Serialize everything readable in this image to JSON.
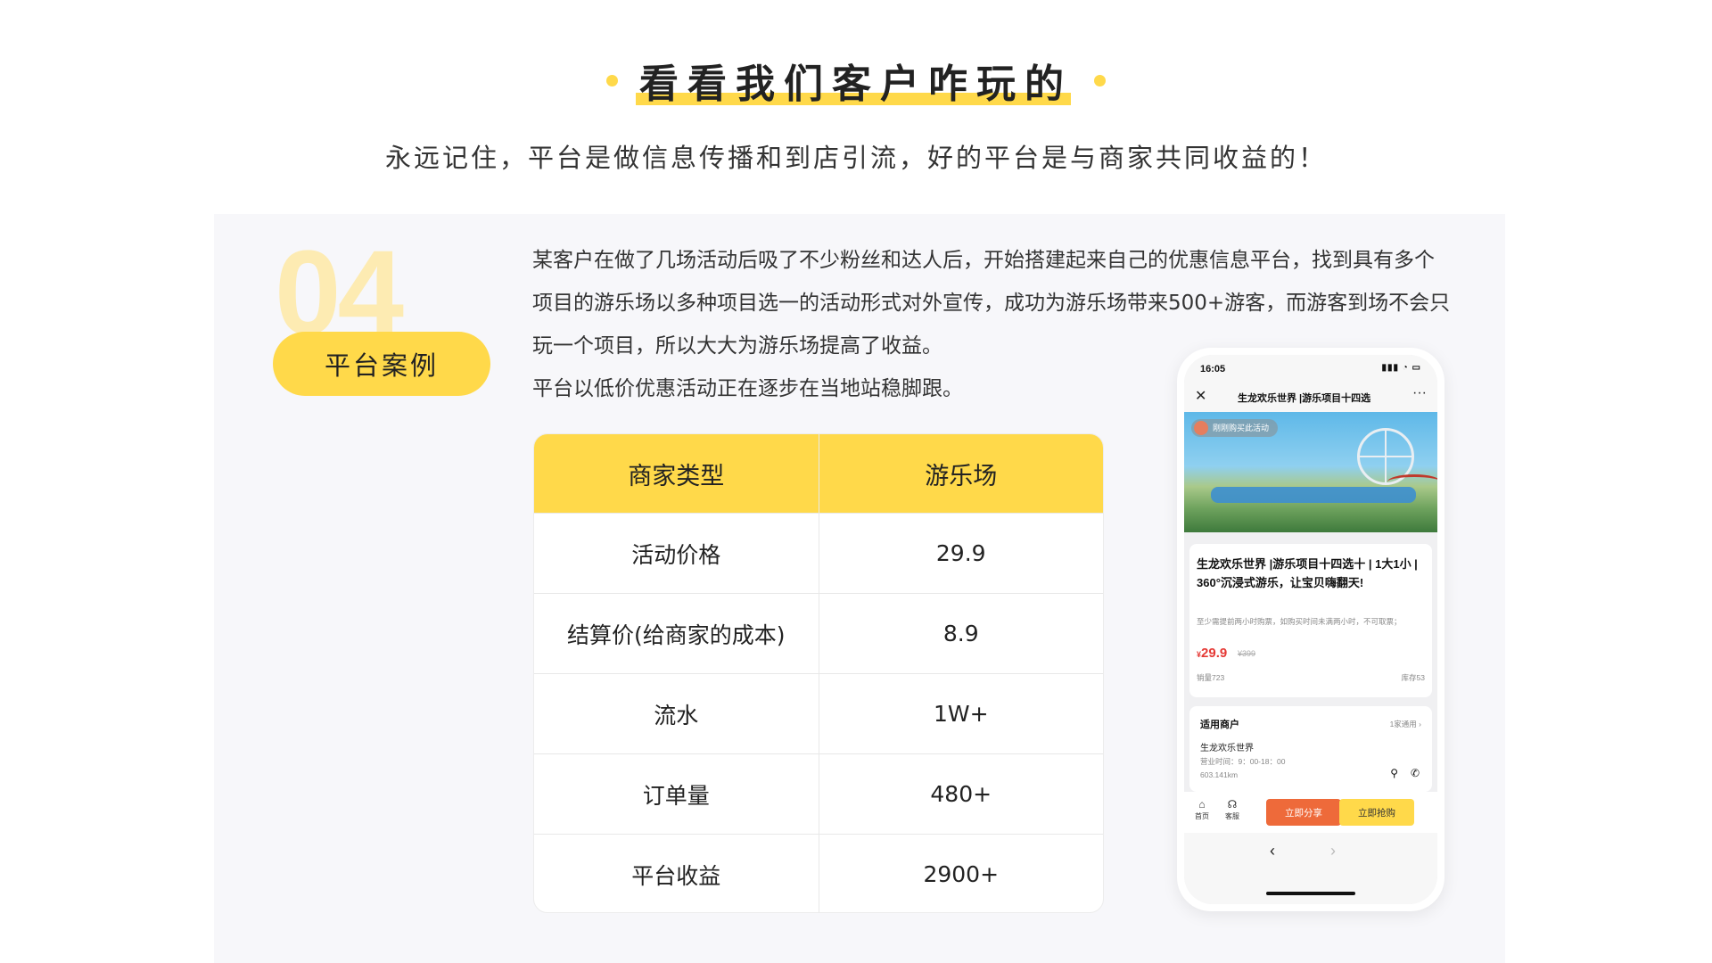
{
  "header": {
    "title": "看看我们客户咋玩的",
    "subtitle": "永远记住，平台是做信息传播和到店引流，好的平台是与商家共同收益的！"
  },
  "case": {
    "number": "04",
    "badge": "平台案例",
    "paragraphs": [
      "某客户在做了几场活动后吸了不少粉丝和达人后，开始搭建起来自己的优惠信息平台，找到具有多个项目的游乐场以多种项目选一的活动形式对外宣传，成功为游乐场带来500+游客，而游客到场不会只玩一个项目，所以大大为游乐场提高了收益。",
      "平台以低价优惠活动正在逐步在当地站稳脚跟。"
    ]
  },
  "table": {
    "header": [
      "商家类型",
      "游乐场"
    ],
    "rows": [
      [
        "活动价格",
        "29.9"
      ],
      [
        "结算价(给商家的成本)",
        "8.9"
      ],
      [
        "流水",
        "1W+"
      ],
      [
        "订单量",
        "480+"
      ],
      [
        "平台收益",
        "2900+"
      ]
    ]
  },
  "phone": {
    "status_time": "16:05",
    "nav_title": "生龙欢乐世界 |游乐项目十四选",
    "banner_tag": "刚刚购买此活动",
    "product_title": "生龙欢乐世界 |游乐项目十四选十 | 1大1小 | 360°沉浸式游乐，让宝贝嗨翻天!",
    "product_note": "至少需提前两小时购票，如购买时间未满两小时，不可取票；",
    "price_symbol": "¥",
    "price": "29.9",
    "old_price": "¥399",
    "sold": "销量723",
    "stock": "库存53",
    "store_section_title": "适用商户",
    "store_count": "1家通用",
    "store_name": "生龙欢乐世界",
    "store_hours": "营业时间：9：00-18：00",
    "store_distance": "603.141km",
    "tab_home": "首页",
    "tab_service": "客服",
    "share_button": "立即分享",
    "buy_button": "立即抢购",
    "icons": [
      "close-icon",
      "more-icon",
      "home-icon",
      "headset-icon",
      "location-pin-icon",
      "phone-icon",
      "back-arrow-icon",
      "forward-arrow-icon"
    ]
  },
  "colors": {
    "accent": "#FFD94A",
    "panel_bg": "#F7F7FA",
    "number_tint": "#FDEBB2",
    "share": "#EE6A3A",
    "price_red": "#E53935"
  }
}
